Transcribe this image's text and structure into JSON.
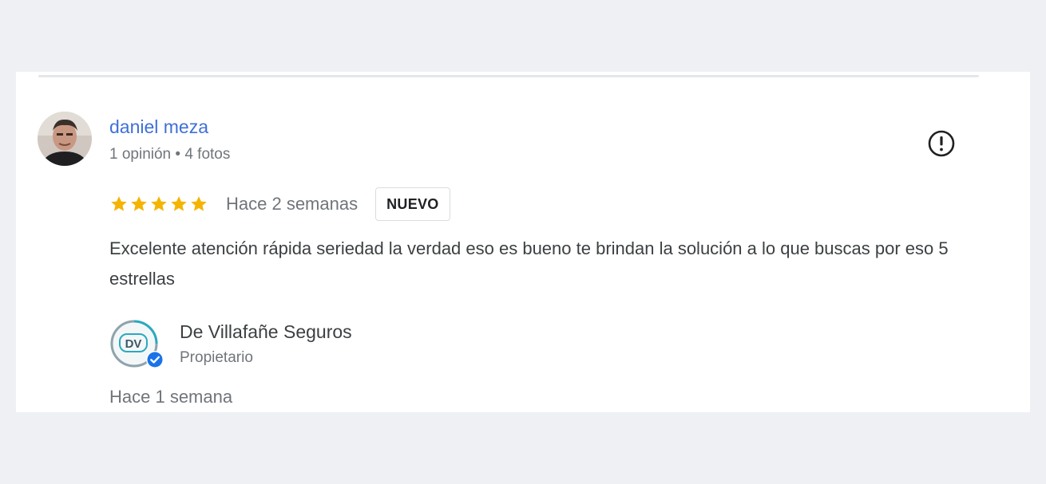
{
  "review": {
    "author": {
      "name": "daniel meza",
      "meta": "1 opinión • 4 fotos",
      "avatar_icon": "profile-photo"
    },
    "report_icon": "alert-circle-icon",
    "rating": {
      "stars": 5,
      "max": 5,
      "color": "#f4b400"
    },
    "date": "Hace 2 semanas",
    "badge": "NUEVO",
    "text": "Excelente atención rápida seriedad la verdad eso es bueno te brindan la solución a lo que buscas por eso 5 estrellas"
  },
  "owner_response": {
    "logo_text": "DV",
    "name": "De Villafañe Seguros",
    "role": "Propietario",
    "verified_icon": "verified-check-icon",
    "date": "Hace 1 semana"
  },
  "colors": {
    "link": "#3f6fd8",
    "star": "#f4b400",
    "verified": "#1a73e8",
    "logo_accent": "#2aa9bf"
  }
}
